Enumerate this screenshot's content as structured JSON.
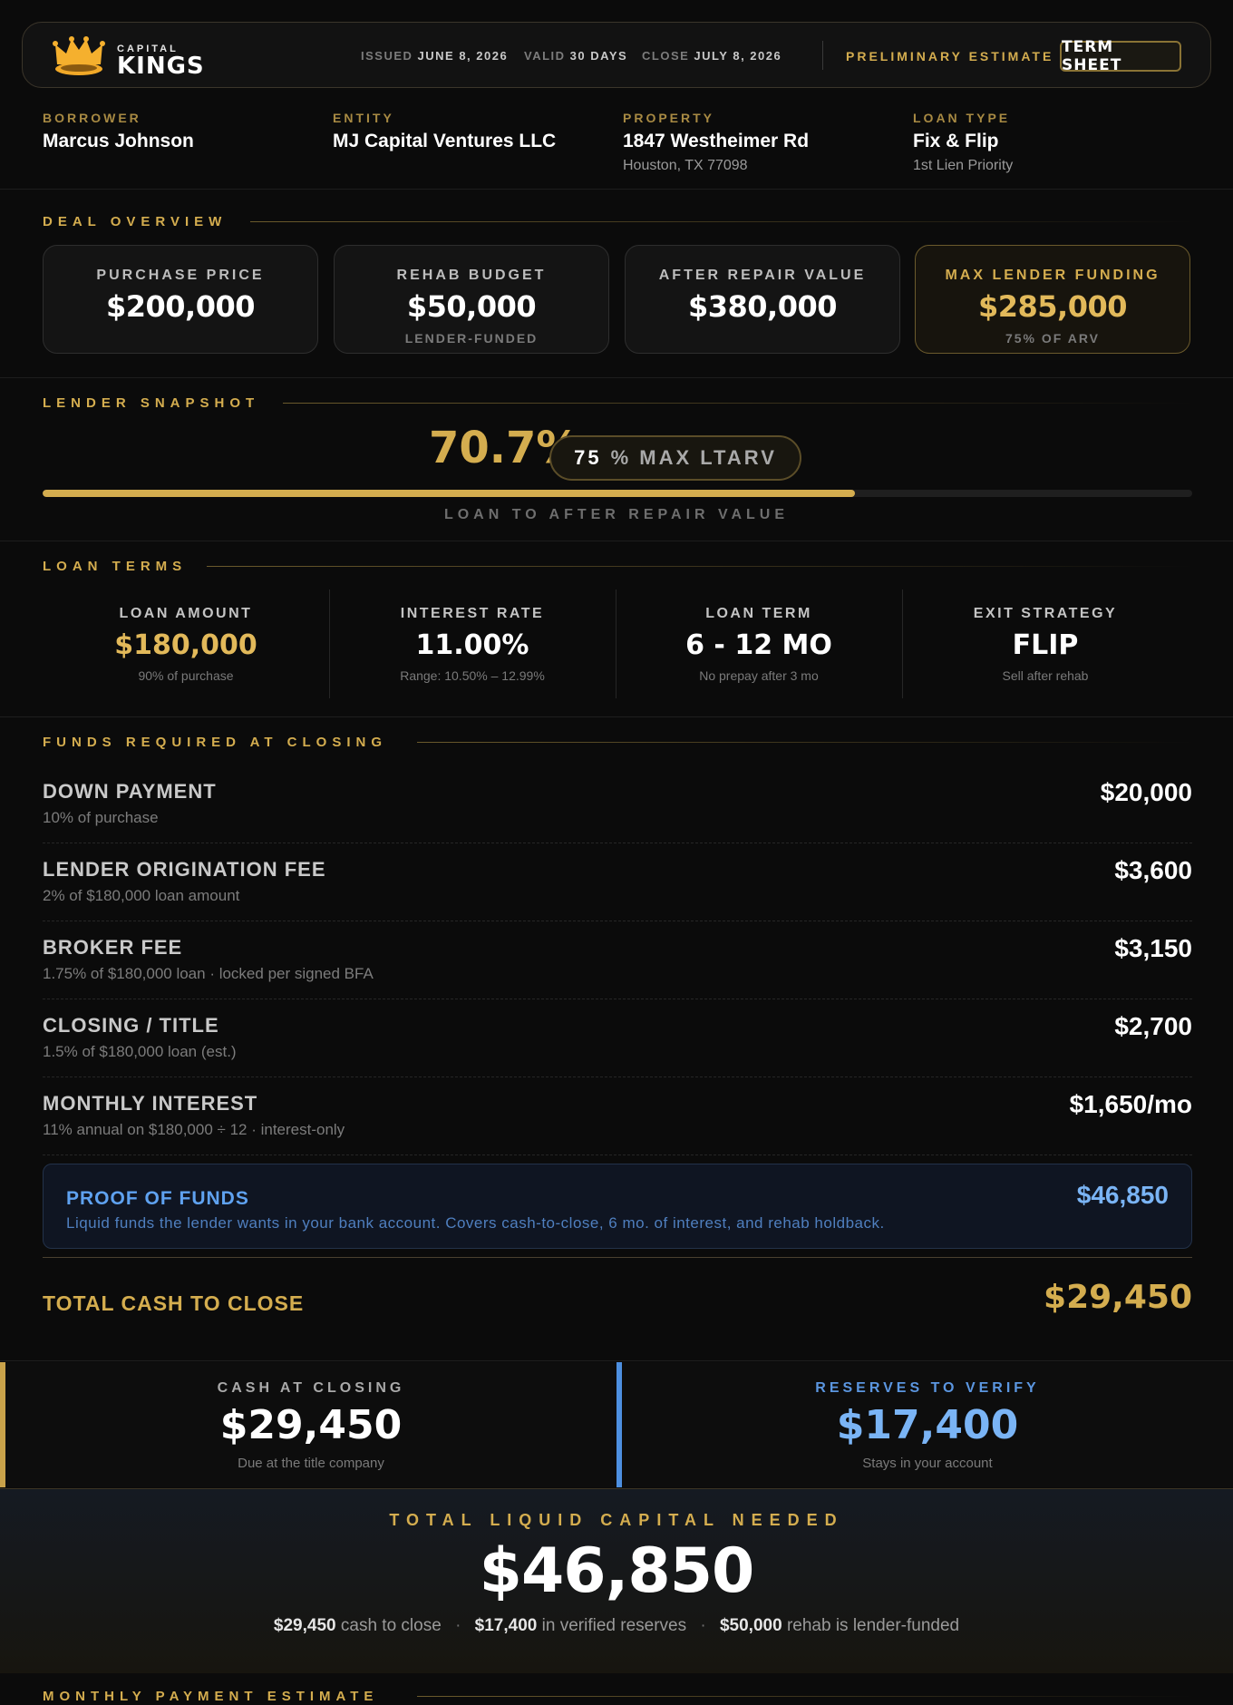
{
  "header": {
    "brand_top": "CAPITAL",
    "brand_main": "KINGS",
    "issued_label": "ISSUED",
    "issued_value": "JUNE 8, 2026",
    "valid_label": "VALID",
    "valid_value": "30 DAYS",
    "close_label": "CLOSE",
    "close_value": "JULY 8, 2026",
    "status": "PRELIMINARY ESTIMATE",
    "term_sheet_button": "TERM SHEET"
  },
  "borrower": {
    "borrower_label": "BORROWER",
    "borrower_value": "Marcus Johnson",
    "entity_label": "ENTITY",
    "entity_value": "MJ Capital Ventures LLC",
    "property_label": "PROPERTY",
    "property_value": "1847 Westheimer Rd",
    "property_sub": "Houston, TX 77098",
    "loan_type_label": "LOAN TYPE",
    "loan_type_value": "Fix & Flip",
    "loan_type_sub": "1st Lien Priority"
  },
  "deal_overview": {
    "title": "DEAL OVERVIEW",
    "cards": [
      {
        "label": "PURCHASE PRICE",
        "value": "$200,000",
        "sub": ""
      },
      {
        "label": "REHAB BUDGET",
        "value": "$50,000",
        "sub": "LENDER-FUNDED"
      },
      {
        "label": "AFTER REPAIR VALUE",
        "value": "$380,000",
        "sub": ""
      },
      {
        "label": "MAX LENDER FUNDING",
        "value": "$285,000",
        "sub": "75% OF ARV"
      }
    ]
  },
  "snapshot": {
    "title": "LENDER SNAPSHOT",
    "ltv": "70.7%",
    "ltv_fraction": 0.707,
    "max_num": "75",
    "max_text": "% MAX LTARV",
    "caption": "LOAN TO AFTER REPAIR VALUE"
  },
  "loan_terms": {
    "title": "LOAN TERMS",
    "items": [
      {
        "label": "LOAN AMOUNT",
        "value": "$180,000",
        "sub": "90% of purchase"
      },
      {
        "label": "INTEREST RATE",
        "value": "11.00%",
        "sub": "Range: 10.50% – 12.99%"
      },
      {
        "label": "LOAN TERM",
        "value": "6 - 12 MO",
        "sub": "No prepay after 3 mo"
      },
      {
        "label": "EXIT STRATEGY",
        "value": "FLIP",
        "sub": "Sell after rehab"
      }
    ]
  },
  "funds": {
    "title": "FUNDS REQUIRED AT CLOSING",
    "items": [
      {
        "label": "DOWN PAYMENT",
        "sub": "10% of purchase",
        "amount": "$20,000"
      },
      {
        "label": "LENDER ORIGINATION FEE",
        "sub": "2% of $180,000 loan amount",
        "amount": "$3,600"
      },
      {
        "label": "BROKER FEE",
        "sub": "1.75% of $180,000 loan · locked per signed BFA",
        "amount": "$3,150"
      },
      {
        "label": "CLOSING / TITLE",
        "sub": "1.5% of $180,000 loan (est.)",
        "amount": "$2,700"
      },
      {
        "label": "MONTHLY INTEREST",
        "sub": "11% annual on $180,000 ÷ 12 · interest-only",
        "amount": "$1,650/mo"
      }
    ],
    "proof": {
      "label": "PROOF OF FUNDS",
      "sub": "Liquid funds the lender wants in your bank account. Covers cash-to-close, 6 mo. of interest, and rehab holdback.",
      "amount": "$46,850"
    },
    "total_label": "TOTAL CASH TO CLOSE",
    "total_amount": "$29,450"
  },
  "split": {
    "cash_label": "CASH AT CLOSING",
    "cash_value": "$29,450",
    "cash_sub": "Due at the title company",
    "reserves_label": "RESERVES TO VERIFY",
    "reserves_value": "$17,400",
    "reserves_sub": "Stays in your account"
  },
  "liquid": {
    "label": "TOTAL LIQUID CAPITAL NEEDED",
    "value": "$46,850",
    "part1_value": "$29,450",
    "part1_text": "cash to close",
    "part2_value": "$17,400",
    "part2_text": "in verified reserves",
    "part3_value": "$50,000",
    "part3_text": "rehab is lender-funded",
    "separator": "·"
  },
  "monthly": {
    "title": "MONTHLY PAYMENT ESTIMATE"
  },
  "colors": {
    "gold": "#d4ad4f",
    "blue": "#5fa2f0",
    "background": "#0b0b0b"
  }
}
